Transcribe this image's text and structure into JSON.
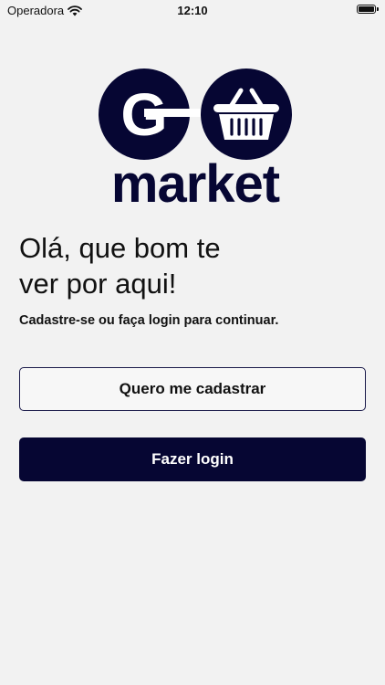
{
  "status_bar": {
    "carrier": "Operadora",
    "time": "12:10",
    "icons": [
      "wifi-icon",
      "battery-icon"
    ]
  },
  "logo": {
    "letter": "G",
    "word": "market",
    "icon": "shopping-basket-icon",
    "brand_color": "#060633"
  },
  "greeting": "Olá, que bom te\nver por aqui!",
  "subtitle": "Cadastre-se ou faça login para continuar.",
  "buttons": {
    "register_label": "Quero me cadastrar",
    "login_label": "Fazer login"
  },
  "colors": {
    "background": "#f2f2f2",
    "primary": "#060633"
  }
}
